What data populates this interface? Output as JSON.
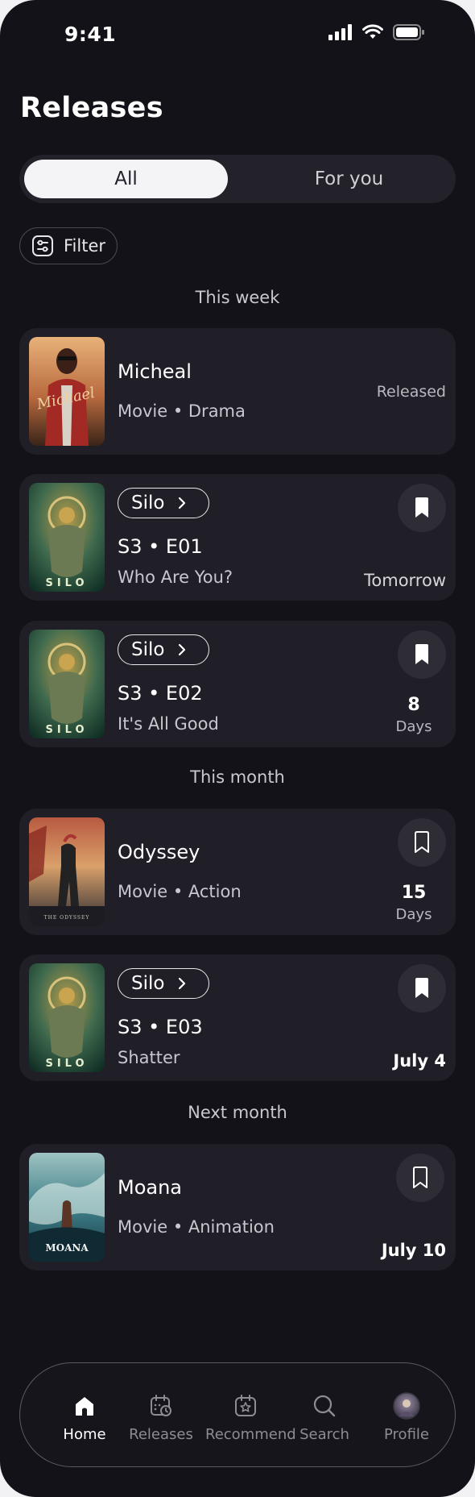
{
  "status_bar": {
    "time": "9:41"
  },
  "page_title": "Releases",
  "segments": {
    "all": "All",
    "for_you": "For you"
  },
  "filter_label": "Filter",
  "sections": {
    "this_week": "This week",
    "this_month": "This month",
    "next_month": "Next month"
  },
  "cards": [
    {
      "title": "Micheal",
      "subtitle": "Movie • Drama",
      "status": "Released",
      "poster_text": "Michael"
    },
    {
      "show": "Silo",
      "episode": "S3 • E01",
      "episode_name": "Who Are You?",
      "when": "Tomorrow",
      "bookmarked": true,
      "poster_text": "SILO"
    },
    {
      "show": "Silo",
      "episode": "S3 • E02",
      "episode_name": "It's All Good",
      "days_num": "8",
      "days_label": "Days",
      "bookmarked": true,
      "poster_text": "SILO"
    },
    {
      "title": "Odyssey",
      "subtitle": "Movie • Action",
      "days_num": "15",
      "days_label": "Days",
      "bookmarked": false,
      "poster_text": "THE ODYSSEY"
    },
    {
      "show": "Silo",
      "episode": "S3 • E03",
      "episode_name": "Shatter",
      "when": "July 4",
      "bookmarked": true,
      "poster_text": "SILO"
    },
    {
      "title": "Moana",
      "subtitle": "Movie • Animation",
      "when": "July 10",
      "bookmarked": false,
      "poster_text": "MOANA"
    }
  ],
  "nav": [
    {
      "label": "Home",
      "icon": "home-icon",
      "active": true
    },
    {
      "label": "Releases",
      "icon": "calendar-clock-icon",
      "active": false
    },
    {
      "label": "Recommend",
      "icon": "calendar-star-icon",
      "active": false
    },
    {
      "label": "Search",
      "icon": "search-icon",
      "active": false
    },
    {
      "label": "Profile",
      "icon": "avatar",
      "active": false
    }
  ],
  "colors": {
    "background": "#141219",
    "card": "#201e26",
    "pill_active": "#f4f4f7",
    "text_muted": "#c8c7cf"
  }
}
